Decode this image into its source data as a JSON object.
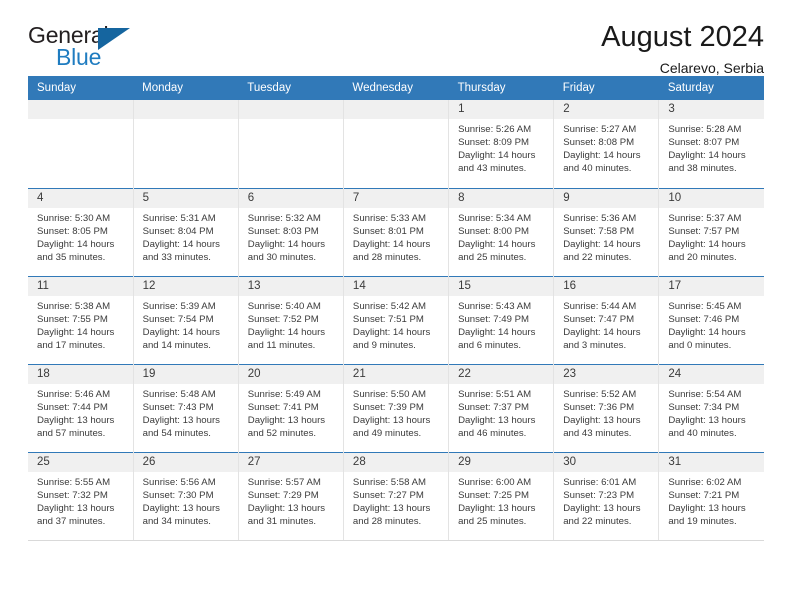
{
  "brand": {
    "name_top": "General",
    "name_bottom": "Blue",
    "accent_color": "#1f7cc0",
    "triangle_color": "#15659f"
  },
  "header": {
    "title": "August 2024",
    "location": "Celarevo, Serbia"
  },
  "calendar": {
    "header_background": "#3179b8",
    "header_text_color": "#ffffff",
    "daynum_band_color": "#f0f0f0",
    "weekday_headers": [
      "Sunday",
      "Monday",
      "Tuesday",
      "Wednesday",
      "Thursday",
      "Friday",
      "Saturday"
    ],
    "weeks": [
      [
        {
          "day": "",
          "sunrise": "",
          "sunset": "",
          "daylight_line1": "",
          "daylight_line2": ""
        },
        {
          "day": "",
          "sunrise": "",
          "sunset": "",
          "daylight_line1": "",
          "daylight_line2": ""
        },
        {
          "day": "",
          "sunrise": "",
          "sunset": "",
          "daylight_line1": "",
          "daylight_line2": ""
        },
        {
          "day": "",
          "sunrise": "",
          "sunset": "",
          "daylight_line1": "",
          "daylight_line2": ""
        },
        {
          "day": "1",
          "sunrise": "Sunrise: 5:26 AM",
          "sunset": "Sunset: 8:09 PM",
          "daylight_line1": "Daylight: 14 hours",
          "daylight_line2": "and 43 minutes."
        },
        {
          "day": "2",
          "sunrise": "Sunrise: 5:27 AM",
          "sunset": "Sunset: 8:08 PM",
          "daylight_line1": "Daylight: 14 hours",
          "daylight_line2": "and 40 minutes."
        },
        {
          "day": "3",
          "sunrise": "Sunrise: 5:28 AM",
          "sunset": "Sunset: 8:07 PM",
          "daylight_line1": "Daylight: 14 hours",
          "daylight_line2": "and 38 minutes."
        }
      ],
      [
        {
          "day": "4",
          "sunrise": "Sunrise: 5:30 AM",
          "sunset": "Sunset: 8:05 PM",
          "daylight_line1": "Daylight: 14 hours",
          "daylight_line2": "and 35 minutes."
        },
        {
          "day": "5",
          "sunrise": "Sunrise: 5:31 AM",
          "sunset": "Sunset: 8:04 PM",
          "daylight_line1": "Daylight: 14 hours",
          "daylight_line2": "and 33 minutes."
        },
        {
          "day": "6",
          "sunrise": "Sunrise: 5:32 AM",
          "sunset": "Sunset: 8:03 PM",
          "daylight_line1": "Daylight: 14 hours",
          "daylight_line2": "and 30 minutes."
        },
        {
          "day": "7",
          "sunrise": "Sunrise: 5:33 AM",
          "sunset": "Sunset: 8:01 PM",
          "daylight_line1": "Daylight: 14 hours",
          "daylight_line2": "and 28 minutes."
        },
        {
          "day": "8",
          "sunrise": "Sunrise: 5:34 AM",
          "sunset": "Sunset: 8:00 PM",
          "daylight_line1": "Daylight: 14 hours",
          "daylight_line2": "and 25 minutes."
        },
        {
          "day": "9",
          "sunrise": "Sunrise: 5:36 AM",
          "sunset": "Sunset: 7:58 PM",
          "daylight_line1": "Daylight: 14 hours",
          "daylight_line2": "and 22 minutes."
        },
        {
          "day": "10",
          "sunrise": "Sunrise: 5:37 AM",
          "sunset": "Sunset: 7:57 PM",
          "daylight_line1": "Daylight: 14 hours",
          "daylight_line2": "and 20 minutes."
        }
      ],
      [
        {
          "day": "11",
          "sunrise": "Sunrise: 5:38 AM",
          "sunset": "Sunset: 7:55 PM",
          "daylight_line1": "Daylight: 14 hours",
          "daylight_line2": "and 17 minutes."
        },
        {
          "day": "12",
          "sunrise": "Sunrise: 5:39 AM",
          "sunset": "Sunset: 7:54 PM",
          "daylight_line1": "Daylight: 14 hours",
          "daylight_line2": "and 14 minutes."
        },
        {
          "day": "13",
          "sunrise": "Sunrise: 5:40 AM",
          "sunset": "Sunset: 7:52 PM",
          "daylight_line1": "Daylight: 14 hours",
          "daylight_line2": "and 11 minutes."
        },
        {
          "day": "14",
          "sunrise": "Sunrise: 5:42 AM",
          "sunset": "Sunset: 7:51 PM",
          "daylight_line1": "Daylight: 14 hours",
          "daylight_line2": "and 9 minutes."
        },
        {
          "day": "15",
          "sunrise": "Sunrise: 5:43 AM",
          "sunset": "Sunset: 7:49 PM",
          "daylight_line1": "Daylight: 14 hours",
          "daylight_line2": "and 6 minutes."
        },
        {
          "day": "16",
          "sunrise": "Sunrise: 5:44 AM",
          "sunset": "Sunset: 7:47 PM",
          "daylight_line1": "Daylight: 14 hours",
          "daylight_line2": "and 3 minutes."
        },
        {
          "day": "17",
          "sunrise": "Sunrise: 5:45 AM",
          "sunset": "Sunset: 7:46 PM",
          "daylight_line1": "Daylight: 14 hours",
          "daylight_line2": "and 0 minutes."
        }
      ],
      [
        {
          "day": "18",
          "sunrise": "Sunrise: 5:46 AM",
          "sunset": "Sunset: 7:44 PM",
          "daylight_line1": "Daylight: 13 hours",
          "daylight_line2": "and 57 minutes."
        },
        {
          "day": "19",
          "sunrise": "Sunrise: 5:48 AM",
          "sunset": "Sunset: 7:43 PM",
          "daylight_line1": "Daylight: 13 hours",
          "daylight_line2": "and 54 minutes."
        },
        {
          "day": "20",
          "sunrise": "Sunrise: 5:49 AM",
          "sunset": "Sunset: 7:41 PM",
          "daylight_line1": "Daylight: 13 hours",
          "daylight_line2": "and 52 minutes."
        },
        {
          "day": "21",
          "sunrise": "Sunrise: 5:50 AM",
          "sunset": "Sunset: 7:39 PM",
          "daylight_line1": "Daylight: 13 hours",
          "daylight_line2": "and 49 minutes."
        },
        {
          "day": "22",
          "sunrise": "Sunrise: 5:51 AM",
          "sunset": "Sunset: 7:37 PM",
          "daylight_line1": "Daylight: 13 hours",
          "daylight_line2": "and 46 minutes."
        },
        {
          "day": "23",
          "sunrise": "Sunrise: 5:52 AM",
          "sunset": "Sunset: 7:36 PM",
          "daylight_line1": "Daylight: 13 hours",
          "daylight_line2": "and 43 minutes."
        },
        {
          "day": "24",
          "sunrise": "Sunrise: 5:54 AM",
          "sunset": "Sunset: 7:34 PM",
          "daylight_line1": "Daylight: 13 hours",
          "daylight_line2": "and 40 minutes."
        }
      ],
      [
        {
          "day": "25",
          "sunrise": "Sunrise: 5:55 AM",
          "sunset": "Sunset: 7:32 PM",
          "daylight_line1": "Daylight: 13 hours",
          "daylight_line2": "and 37 minutes."
        },
        {
          "day": "26",
          "sunrise": "Sunrise: 5:56 AM",
          "sunset": "Sunset: 7:30 PM",
          "daylight_line1": "Daylight: 13 hours",
          "daylight_line2": "and 34 minutes."
        },
        {
          "day": "27",
          "sunrise": "Sunrise: 5:57 AM",
          "sunset": "Sunset: 7:29 PM",
          "daylight_line1": "Daylight: 13 hours",
          "daylight_line2": "and 31 minutes."
        },
        {
          "day": "28",
          "sunrise": "Sunrise: 5:58 AM",
          "sunset": "Sunset: 7:27 PM",
          "daylight_line1": "Daylight: 13 hours",
          "daylight_line2": "and 28 minutes."
        },
        {
          "day": "29",
          "sunrise": "Sunrise: 6:00 AM",
          "sunset": "Sunset: 7:25 PM",
          "daylight_line1": "Daylight: 13 hours",
          "daylight_line2": "and 25 minutes."
        },
        {
          "day": "30",
          "sunrise": "Sunrise: 6:01 AM",
          "sunset": "Sunset: 7:23 PM",
          "daylight_line1": "Daylight: 13 hours",
          "daylight_line2": "and 22 minutes."
        },
        {
          "day": "31",
          "sunrise": "Sunrise: 6:02 AM",
          "sunset": "Sunset: 7:21 PM",
          "daylight_line1": "Daylight: 13 hours",
          "daylight_line2": "and 19 minutes."
        }
      ]
    ]
  }
}
